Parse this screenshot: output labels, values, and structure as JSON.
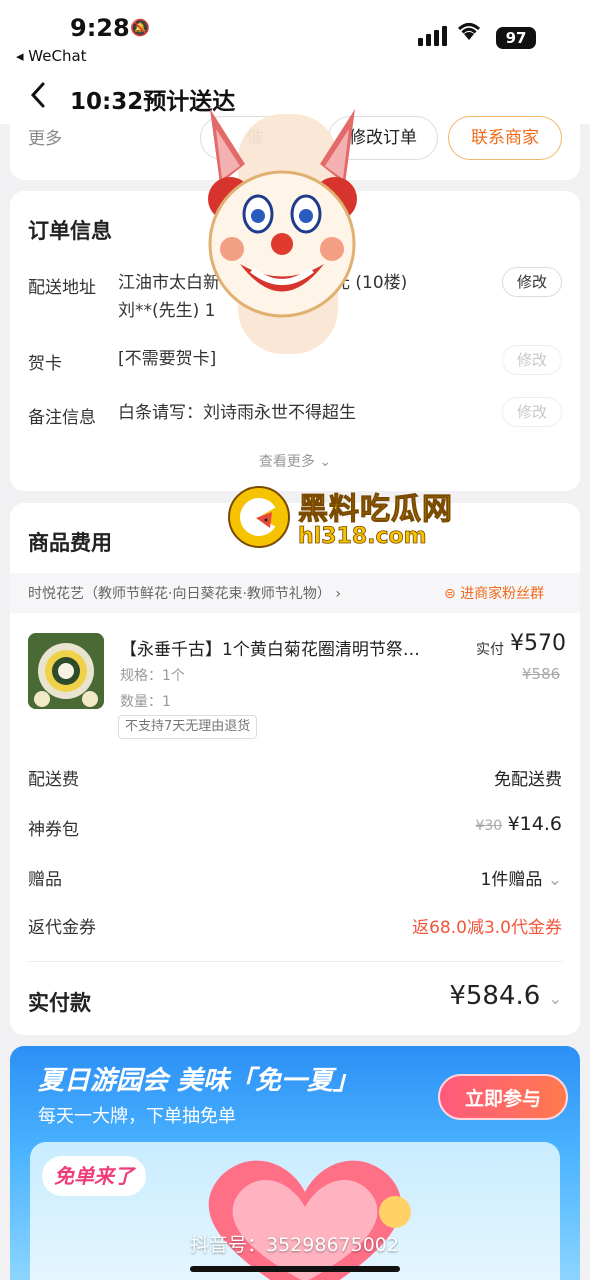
{
  "status_bar": {
    "time": "9:28",
    "back_app": "◂ WeChat",
    "battery": "97"
  },
  "nav": {
    "title": "10:32预计送达"
  },
  "actions": {
    "more_label": "更多",
    "partial_label": "催",
    "modify_order": "修改订单",
    "contact_merchant": "联系商家"
  },
  "order_info": {
    "title": "订单信息",
    "rows": [
      {
        "label": "配送地址",
        "value_line1": "江油市太白新",
        "value_line1b": "单元 (10楼)",
        "value_line2": "刘**(先生) 1",
        "edit": "修改"
      },
      {
        "label": "贺卡",
        "value_line1": "[不需要贺卡]",
        "edit": "修改"
      },
      {
        "label": "备注信息",
        "value_line1": "白条请写：刘诗雨永世不得超生",
        "edit": "修改"
      }
    ],
    "see_more": "查看更多"
  },
  "fees": {
    "title": "商品费用",
    "shop_name": "时悦花艺（教师节鲜花·向日葵花束·教师节礼物）",
    "fans_group": "进商家粉丝群",
    "product": {
      "title": "【永垂千古】1个黄白菊花圈清明节祭…",
      "spec": "规格：1个",
      "quantity": "数量：1",
      "tag": "不支持7天无理由退货",
      "paid_label": "实付",
      "paid_value": "¥570",
      "original_price": "¥586"
    },
    "rows": [
      {
        "label": "配送费",
        "value": "免配送费"
      },
      {
        "label": "神券包",
        "value_strike": "¥30",
        "value": "¥14.6"
      },
      {
        "label": "赠品",
        "value": "1件赠品"
      },
      {
        "label": "返代金券",
        "value": "返68.0减3.0代金券"
      }
    ],
    "total_label": "实付款",
    "total_value": "¥584.6"
  },
  "banner": {
    "title": "夏日游园会  美味「免一夏」",
    "subtitle": "每天一大牌，下单抽免单",
    "cta": "立即参与",
    "free_tag": "免单来了",
    "douyin_id": "抖音号：35298675002"
  },
  "watermark": {
    "name": "黑料吃瓜网",
    "site": "hl318.com"
  },
  "colors": {
    "accent": "#f06b1c",
    "red": "#f2563a",
    "banner_blue": "#2c8ff5"
  }
}
